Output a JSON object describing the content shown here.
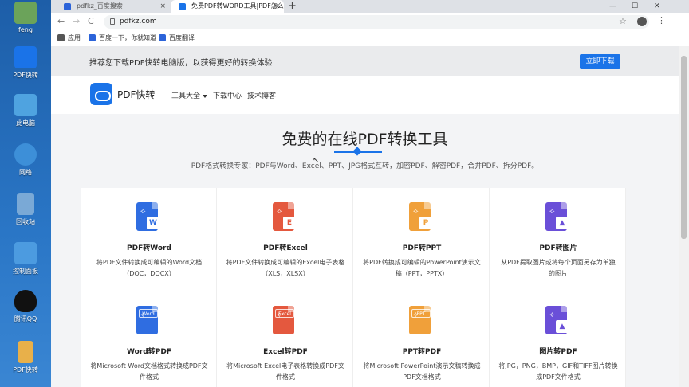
{
  "desktop": {
    "user": "feng",
    "icons": [
      {
        "label": "PDF快转",
        "color": "#1a73e8"
      },
      {
        "label": "此电脑",
        "color": "#4fa3e0"
      },
      {
        "label": "网络",
        "color": "#3d8fd8"
      },
      {
        "label": "回收站",
        "color": "#7aa9d6"
      },
      {
        "label": "控制面板",
        "color": "#4c9be0"
      },
      {
        "label": "腾讯QQ",
        "color": "#111111"
      },
      {
        "label": "PDF快转",
        "color": "#e8b04a"
      }
    ]
  },
  "browser": {
    "tabs": [
      {
        "title": "pdfkz_百度搜索",
        "close": "×",
        "icon_color": "#2b63d9"
      },
      {
        "title": "免费PDF转WORD工具|PDF怎么",
        "close": "×",
        "icon_color": "#1a73e8"
      }
    ],
    "new_tab": "+",
    "window_controls": {
      "minimize": "—",
      "maximize": "☐",
      "close": "✕"
    },
    "nav": {
      "back": "←",
      "forward": "→",
      "reload": "C"
    },
    "url": "pdfkz.com",
    "bookmarks": [
      {
        "label": "应用",
        "icon_color": "#555555"
      },
      {
        "label": "百度一下，你就知道",
        "icon_color": "#2b63d9"
      },
      {
        "label": "百度翻译",
        "icon_color": "#2b63d9"
      }
    ]
  },
  "page": {
    "promo_text": "推荐您下载PDF快转电脑版，以获得更好的转换体验",
    "promo_button": "立即下载",
    "brand": "PDF快转",
    "nav": [
      "工具大全",
      "下载中心",
      "技术博客"
    ],
    "hero_title": "免费的在线PDF转换工具",
    "hero_subtitle": "PDF格式转换专家：PDF与Word、Excel、PPT、JPG格式互转，加密PDF、解密PDF，合并PDF、拆分PDF。",
    "tools": [
      {
        "title": "PDF转Word",
        "desc": "将PDF文件转换成可编辑的Word文档（DOC，DOCX）",
        "color": "#2f6de1",
        "badge": "W",
        "badge_color": "#2f6de1"
      },
      {
        "title": "PDF转Excel",
        "desc": "将PDF文件转换成可编辑的Excel电子表格（XLS，XLSX）",
        "color": "#e4583e",
        "badge": "E",
        "badge_color": "#e4583e"
      },
      {
        "title": "PDF转PPT",
        "desc": "将PDF转换成可编辑的PowerPoint演示文稿（PPT，PPTX）",
        "color": "#f0a03a",
        "badge": "P",
        "badge_color": "#f0a03a"
      },
      {
        "title": "PDF转图片",
        "desc": "从PDF提取图片或将每个页面另存为单独的图片",
        "color": "#6a4fd8",
        "badge": "▲",
        "badge_color": "#6a4fd8"
      },
      {
        "title": "Word转PDF",
        "desc": "将Microsoft Word文档格式转换成PDF文件格式",
        "color": "#2f6de1",
        "badge": "Word",
        "badge_color": "#2f6de1"
      },
      {
        "title": "Excel转PDF",
        "desc": "将Microsoft Excel电子表格转换成PDF文件格式",
        "color": "#e4583e",
        "badge": "Excel",
        "badge_color": "#e4583e"
      },
      {
        "title": "PPT转PDF",
        "desc": "将Microsoft PowerPoint演示文稿转换成PDF文档格式",
        "color": "#f0a03a",
        "badge": "PPT",
        "badge_color": "#f0a03a"
      },
      {
        "title": "图片转PDF",
        "desc": "将JPG，PNG，BMP，GIF和TIFF图片转换成PDF文件格式",
        "color": "#6a4fd8",
        "badge": "▲",
        "badge_color": "#6a4fd8"
      }
    ]
  }
}
